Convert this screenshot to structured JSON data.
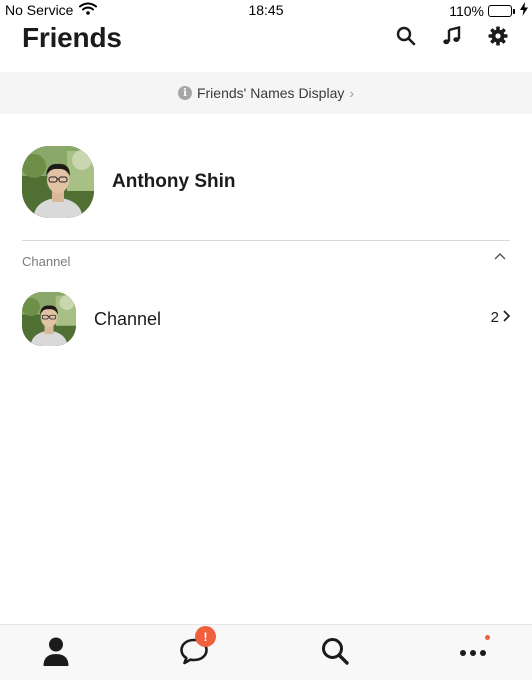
{
  "status_bar": {
    "carrier": "No Service",
    "time": "18:45",
    "battery": "110%",
    "battery_level": 1.0,
    "icons": [
      "wifi-icon",
      "battery-icon",
      "charging-bolt-icon"
    ]
  },
  "header": {
    "title": "Friends",
    "icons": [
      "search-icon",
      "music-note-icon",
      "gear-icon"
    ]
  },
  "banner": {
    "label": "Friends' Names Display",
    "info_glyph": "i",
    "chevron": "›"
  },
  "profile": {
    "name": "Anthony Shin",
    "avatar_icon": "profile-photo"
  },
  "channel_section": {
    "label": "Channel",
    "collapse_icon": "chevron-up-icon",
    "rows": [
      {
        "name": "Channel",
        "count": "2",
        "chevron": "›"
      }
    ]
  },
  "tab_bar": {
    "tabs": [
      {
        "name": "friends",
        "icon": "person-icon",
        "active": true
      },
      {
        "name": "chats",
        "icon": "chat-bubble-icon",
        "badge": "!"
      },
      {
        "name": "search",
        "icon": "search-icon"
      },
      {
        "name": "more",
        "icon": "more-icon",
        "dot": true
      }
    ]
  },
  "colors": {
    "accent_badge": "#f05f3e",
    "banner_bg": "#f5f5f5",
    "text": "#1b1b1b",
    "muted": "#7a7a7a"
  }
}
